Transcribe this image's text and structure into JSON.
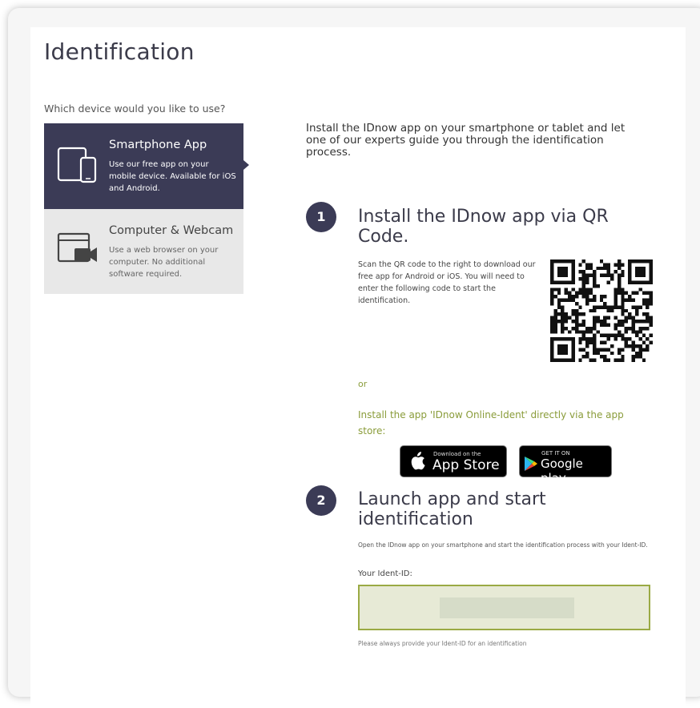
{
  "page": {
    "title": "Identification"
  },
  "device": {
    "question": "Which device would you like to use?",
    "options": [
      {
        "title": "Smartphone App",
        "description": "Use our free app on your mobile device. Available for iOS and Android.",
        "icon": "tablet-phone-icon",
        "selected": true
      },
      {
        "title": "Computer & Webcam",
        "description": "Use a web browser on your computer. No additional software required.",
        "icon": "computer-webcam-icon",
        "selected": false
      }
    ]
  },
  "intro": "Install the IDnow app on your smartphone or tablet and let one of our experts guide you through the identification process.",
  "steps": [
    {
      "number": "1",
      "title": "Install the IDnow app via QR Code.",
      "text": "Scan the QR code to the right to download our free app for Android or iOS. You will need to enter the following code to start the identification."
    },
    {
      "number": "2",
      "title": "Launch app and start identification",
      "text": "Open the IDnow app on your smartphone and start the identification process with your Ident-ID."
    }
  ],
  "store": {
    "or": "or",
    "text": "Install the app 'IDnow Online-Ident' directly via the app store:",
    "app_store": {
      "small": "Download on the",
      "big": "App Store"
    },
    "google_play": {
      "small": "GET IT ON",
      "big": "Google play"
    }
  },
  "ident": {
    "label": "Your Ident-ID:",
    "value": "",
    "hint": "Please always provide your Ident-ID for an identification"
  },
  "colors": {
    "accent": "#3b3b56",
    "green": "#8a9c3a",
    "ident_bg": "#e7ead6",
    "ident_border": "#9aaa44"
  }
}
